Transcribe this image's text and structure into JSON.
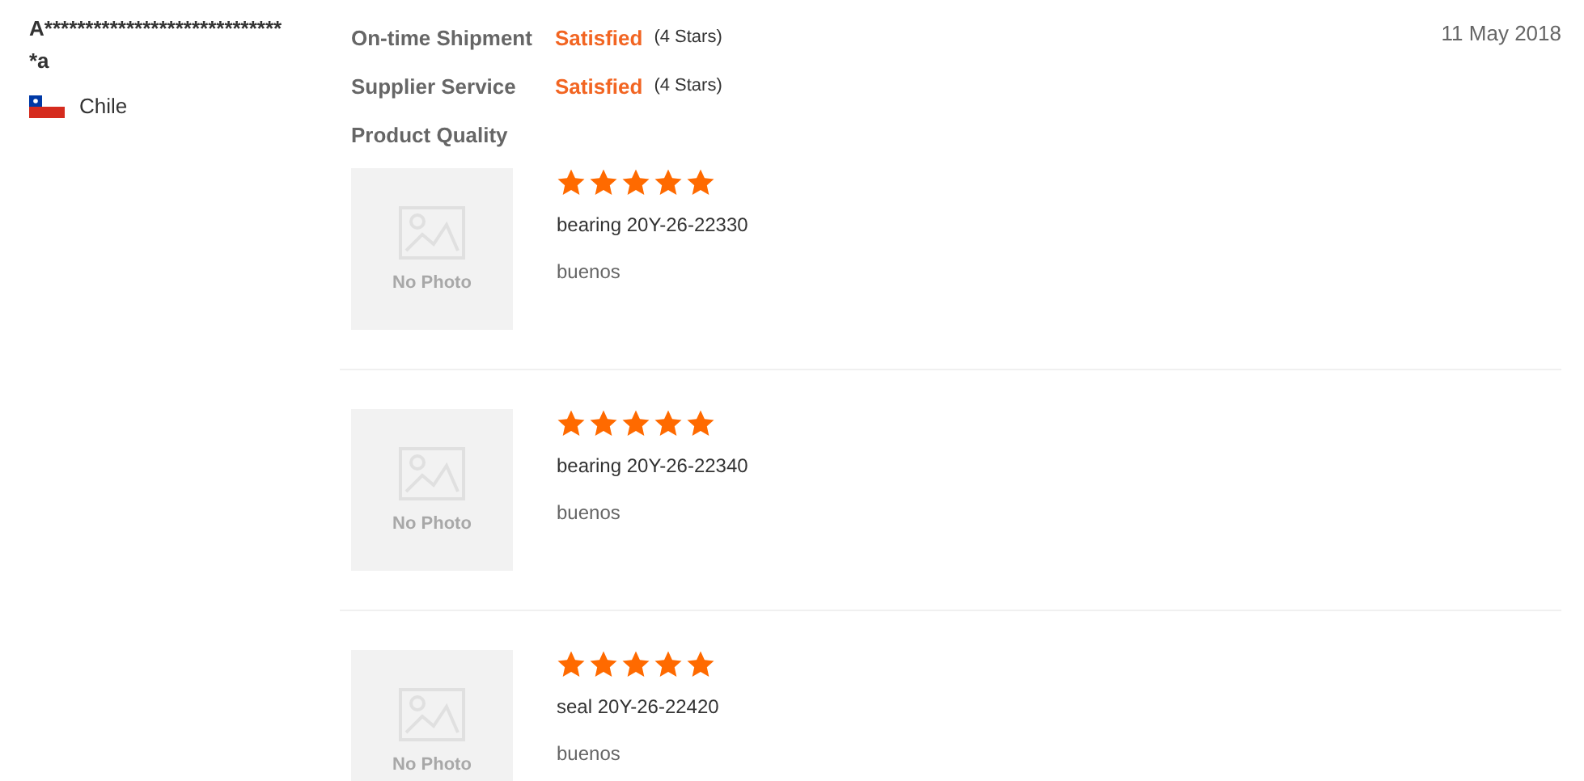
{
  "reviewer": {
    "name": "A******************************a",
    "country": "Chile"
  },
  "ratings": [
    {
      "label": "On-time Shipment",
      "verdict": "Satisfied",
      "stars_text": "(4 Stars)"
    },
    {
      "label": "Supplier Service",
      "verdict": "Satisfied",
      "stars_text": "(4 Stars)"
    }
  ],
  "date": "11 May 2018",
  "product_quality_label": "Product Quality",
  "products": [
    {
      "photo_text": "No Photo",
      "stars": 5,
      "name": "bearing 20Y-26-22330",
      "comment": "buenos"
    },
    {
      "photo_text": "No Photo",
      "stars": 5,
      "name": "bearing 20Y-26-22340",
      "comment": "buenos"
    },
    {
      "photo_text": "No Photo",
      "stars": 5,
      "name": "seal 20Y-26-22420",
      "comment": "buenos"
    }
  ]
}
